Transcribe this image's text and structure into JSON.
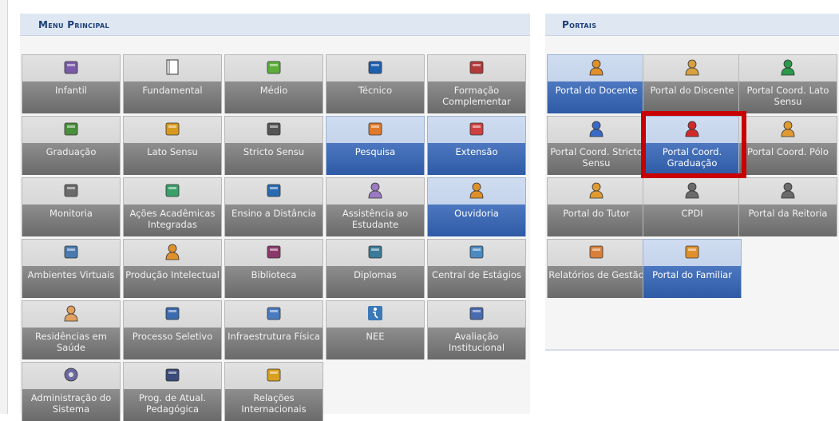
{
  "main_menu": {
    "title": "Menu Principal",
    "tiles": [
      {
        "label": "Infantil",
        "icon": "pencil-cup-icon"
      },
      {
        "label": "Fundamental",
        "icon": "notebook-icon"
      },
      {
        "label": "Médio",
        "icon": "crayon-icon"
      },
      {
        "label": "Técnico",
        "icon": "blue-book-icon"
      },
      {
        "label": "Formação Complementar",
        "icon": "red-book-icon"
      },
      {
        "label": "Graduação",
        "icon": "books-stack-icon"
      },
      {
        "label": "Lato Sensu",
        "icon": "folder-icon"
      },
      {
        "label": "Stricto Sensu",
        "icon": "briefcase-icon"
      },
      {
        "label": "Pesquisa",
        "icon": "flask-icon"
      },
      {
        "label": "Extensão",
        "icon": "house-icon"
      },
      {
        "label": "Monitoria",
        "icon": "presentation-board-icon"
      },
      {
        "label": "Ações Acadêmicas Integradas",
        "icon": "puzzle-icon"
      },
      {
        "label": "Ensino a Distância",
        "icon": "globe-user-icon"
      },
      {
        "label": "Assistência ao Estudante",
        "icon": "student-support-icon"
      },
      {
        "label": "Ouvidoria",
        "icon": "headset-user-icon"
      },
      {
        "label": "Ambientes Virtuais",
        "icon": "group-users-icon"
      },
      {
        "label": "Produção Intelectual",
        "icon": "user-check-icon"
      },
      {
        "label": "Biblioteca",
        "icon": "book-stack-icon"
      },
      {
        "label": "Diplomas",
        "icon": "diploma-icon"
      },
      {
        "label": "Central de Estágios",
        "icon": "contact-book-icon"
      },
      {
        "label": "Residências em Saúde",
        "icon": "doctor-icon"
      },
      {
        "label": "Processo Seletivo",
        "icon": "database-computer-icon"
      },
      {
        "label": "Infraestrutura Física",
        "icon": "network-icon"
      },
      {
        "label": "NEE",
        "icon": "accessibility-icon"
      },
      {
        "label": "Avaliação Institucional",
        "icon": "checklist-icon"
      },
      {
        "label": "Administração do Sistema",
        "icon": "gear-icon"
      },
      {
        "label": "Prog. de Atual. Pedagógica",
        "icon": "monitor-teacher-icon"
      },
      {
        "label": "Relações Internacionais",
        "icon": "world-map-icon"
      }
    ],
    "active_labels": [
      "Pesquisa",
      "Extensão",
      "Ouvidoria"
    ]
  },
  "portals": {
    "title": "Portais",
    "tiles": [
      {
        "label": "Portal do Docente",
        "icon": "teacher-icon"
      },
      {
        "label": "Portal do Discente",
        "icon": "student-icon"
      },
      {
        "label": "Portal Coord. Lato Sensu",
        "icon": "green-user-icon"
      },
      {
        "label": "Portal Coord. Stricto Sensu",
        "icon": "blue-user-icon"
      },
      {
        "label": "Portal Coord. Graduação",
        "icon": "red-user-icon"
      },
      {
        "label": "Portal Coord. Pólo",
        "icon": "user-icon"
      },
      {
        "label": "Portal do Tutor",
        "icon": "tutor-icon"
      },
      {
        "label": "CPDI",
        "icon": "manager-icon"
      },
      {
        "label": "Portal da Reitoria",
        "icon": "executive-icon"
      },
      {
        "label": "Relatórios de Gestão",
        "icon": "report-chart-icon"
      },
      {
        "label": "Portal do Familiar",
        "icon": "family-icon"
      }
    ],
    "active_labels": [
      "Portal do Docente",
      "Portal Coord. Graduação",
      "Portal do Familiar"
    ]
  },
  "colors": {
    "accent": "#2e5aa6",
    "highlight_box": "#c80000",
    "header_text": "#1c3f7a"
  }
}
